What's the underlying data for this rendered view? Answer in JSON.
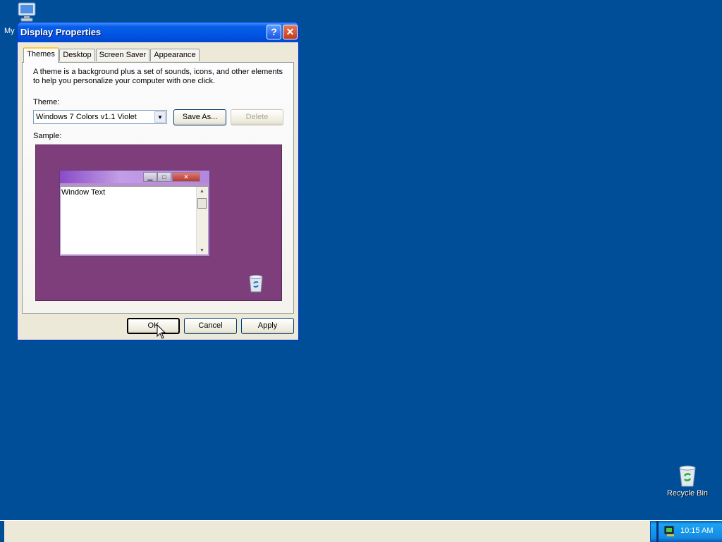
{
  "desktop": {
    "icons": [
      {
        "label": "My"
      },
      {
        "label": "Recycle Bin"
      }
    ]
  },
  "window": {
    "title": "Display Properties",
    "help_label": "?",
    "close_label": "✕",
    "tabs": [
      {
        "label": "Themes",
        "active": true
      },
      {
        "label": "Desktop"
      },
      {
        "label": "Screen Saver"
      },
      {
        "label": "Appearance"
      }
    ],
    "description": "A theme is a background plus a set of sounds, icons, and other elements to help you personalize your computer with one click.",
    "theme_label": "Theme:",
    "theme_value": "Windows 7 Colors v1.1 Violet",
    "save_as_label": "Save As...",
    "delete_label": "Delete",
    "sample_label": "Sample:",
    "sample": {
      "window_text": "Window Text",
      "background_color": "#7e3d7b"
    },
    "ok_label": "OK",
    "cancel_label": "Cancel",
    "apply_label": "Apply"
  },
  "taskbar": {
    "clock": "10:15 AM"
  },
  "colors": {
    "desktop": "#004e98",
    "dialog_face": "#ece9d8",
    "titlebar": "#0055e5"
  }
}
